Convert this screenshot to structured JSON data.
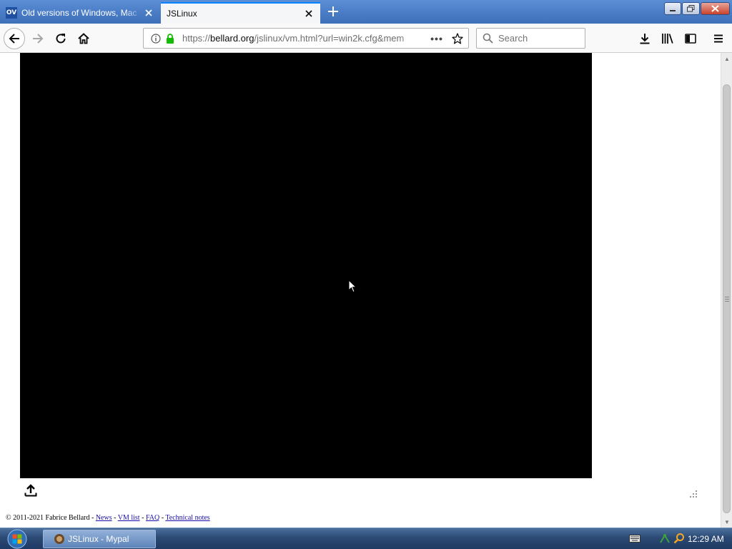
{
  "browser": {
    "tabs": [
      {
        "favicon_text": "OV",
        "title": "Old versions of Windows, Mac"
      },
      {
        "title": "JSLinux"
      }
    ],
    "url": {
      "prefix": "https://",
      "host": "bellard.org",
      "path": "/jslinux/vm.html?url=win2k.cfg&mem"
    },
    "search_placeholder": "Search"
  },
  "page": {
    "footer": {
      "copyright": "© 2011-2021 Fabrice Bellard - ",
      "links": [
        "News",
        "VM list",
        "FAQ",
        "Technical notes"
      ],
      "separator": " - "
    }
  },
  "taskbar": {
    "task_label": "JSLinux - Mypal",
    "clock": "12:29 AM"
  }
}
